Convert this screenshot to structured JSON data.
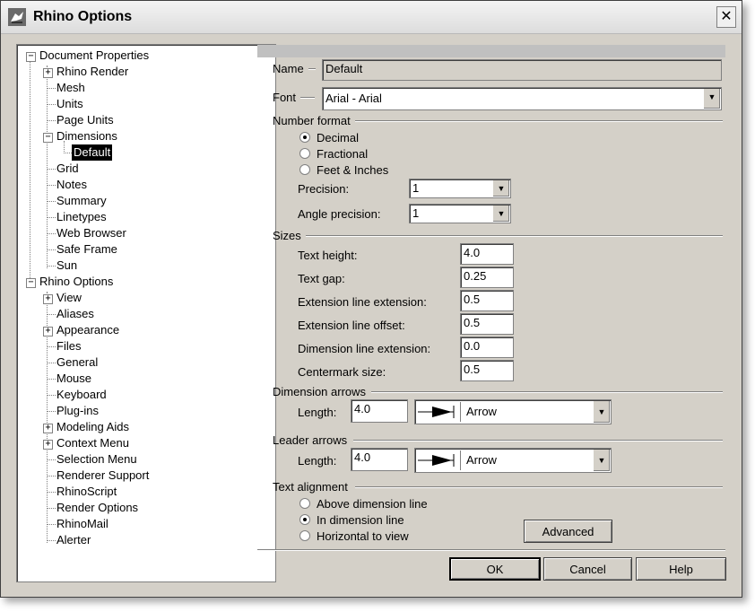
{
  "window": {
    "title": "Rhino Options",
    "close_glyph": "✕"
  },
  "tree": {
    "document_properties": "Document Properties",
    "rhino_render": "Rhino Render",
    "mesh": "Mesh",
    "units": "Units",
    "page_units": "Page Units",
    "dimensions": "Dimensions",
    "default": "Default",
    "grid": "Grid",
    "notes": "Notes",
    "summary": "Summary",
    "linetypes": "Linetypes",
    "web_browser": "Web Browser",
    "safe_frame": "Safe Frame",
    "sun": "Sun",
    "rhino_options": "Rhino Options",
    "view": "View",
    "aliases": "Aliases",
    "appearance": "Appearance",
    "files": "Files",
    "general": "General",
    "mouse": "Mouse",
    "keyboard": "Keyboard",
    "plugins": "Plug-ins",
    "modeling_aids": "Modeling Aids",
    "context_menu": "Context Menu",
    "selection_menu": "Selection Menu",
    "renderer_support": "Renderer Support",
    "rhinoscript": "RhinoScript",
    "render_options": "Render Options",
    "rhinomail": "RhinoMail",
    "alerter": "Alerter",
    "plus": "+",
    "minus": "−"
  },
  "form": {
    "name_label": "Name",
    "name_value": "Default",
    "font_label": "Font",
    "font_value": "Arial - Arial",
    "number_format_label": "Number format",
    "decimal": "Decimal",
    "fractional": "Fractional",
    "feet_inches": "Feet & Inches",
    "precision_label": "Precision:",
    "precision_value": "1",
    "angle_precision_label": "Angle precision:",
    "angle_precision_value": "1",
    "sizes_label": "Sizes",
    "text_height_label": "Text height:",
    "text_height_value": "4.0",
    "text_gap_label": "Text gap:",
    "text_gap_value": "0.25",
    "ext_line_ext_label": "Extension line extension:",
    "ext_line_ext_value": "0.5",
    "ext_line_offset_label": "Extension line offset:",
    "ext_line_offset_value": "0.5",
    "dim_line_ext_label": "Dimension line extension:",
    "dim_line_ext_value": "0.0",
    "centermark_label": "Centermark size:",
    "centermark_value": "0.5",
    "dim_arrows_label": "Dimension arrows",
    "dim_length_label": "Length:",
    "dim_length_value": "4.0",
    "dim_arrow_type": "Arrow",
    "leader_arrows_label": "Leader arrows",
    "leader_length_label": "Length:",
    "leader_length_value": "4.0",
    "leader_arrow_type": "Arrow",
    "text_alignment_label": "Text alignment",
    "above_line": "Above dimension line",
    "in_line": "In dimension line",
    "horizontal": "Horizontal to view",
    "advanced": "Advanced",
    "dropdown_glyph": "▼"
  },
  "buttons": {
    "ok": "OK",
    "cancel": "Cancel",
    "help": "Help"
  },
  "state": {
    "number_format": "Decimal",
    "text_alignment": "In dimension line"
  }
}
